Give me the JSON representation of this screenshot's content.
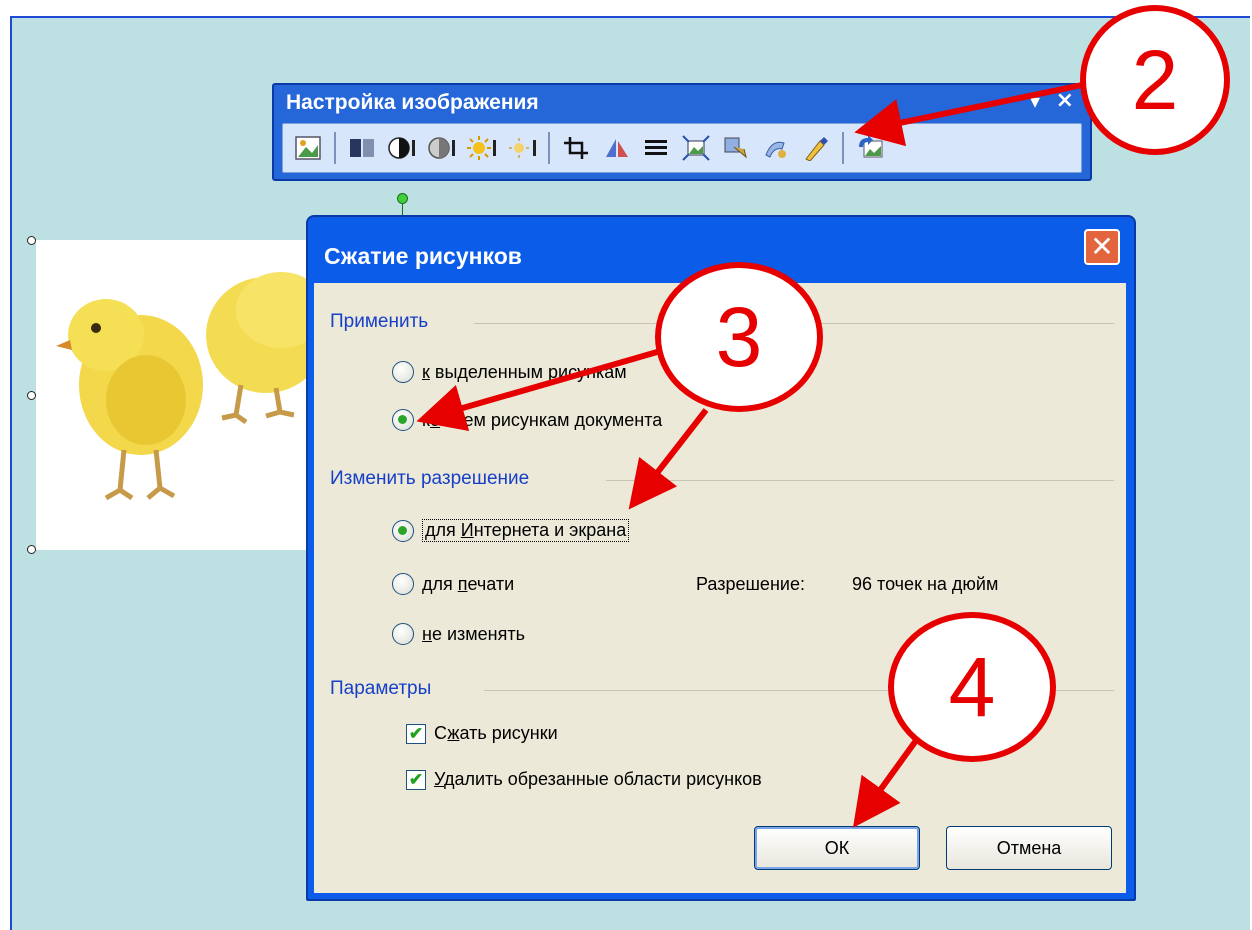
{
  "toolbar": {
    "title": "Настройка изображения",
    "minimize_label": "▾",
    "close_label": "×",
    "buttons": [
      "insert-picture-icon",
      "color-icon",
      "more-contrast-icon",
      "less-contrast-icon",
      "more-brightness-icon",
      "less-brightness-icon",
      "crop-icon",
      "rotate-left-icon",
      "line-style-icon",
      "compress-pictures-icon",
      "text-wrapping-icon",
      "format-picture-icon",
      "set-transparent-color-icon",
      "reset-picture-icon"
    ]
  },
  "dialog": {
    "title": "Сжатие рисунков",
    "close_label": "✕",
    "apply": {
      "label": "Применить",
      "option_selected": {
        "prefix": "",
        "underline": "к",
        "rest": " выделенным рисункам"
      },
      "option_all": {
        "prefix": "к",
        "underline": "о",
        "rest": " всем рисункам документа"
      },
      "selected": "all"
    },
    "resolution": {
      "label": "Изменить разрешение",
      "option_web": {
        "prefix": "для ",
        "underline": "И",
        "rest": "нтернета и экрана"
      },
      "option_print": {
        "prefix": "для ",
        "underline": "п",
        "rest": "ечати"
      },
      "option_none": {
        "prefix": "",
        "underline": "н",
        "rest": "е изменять"
      },
      "selected": "web",
      "info_label": "Разрешение:",
      "info_value": "96 точек на дюйм"
    },
    "params": {
      "label": "Параметры",
      "compress": {
        "prefix": "С",
        "underline": "ж",
        "rest": "ать рисунки",
        "checked": true
      },
      "delete_cropped": {
        "prefix": "",
        "underline": "У",
        "rest": "далить обрезанные области рисунков",
        "checked": true
      }
    },
    "ok_label": "ОК",
    "cancel_label": "Отмена"
  },
  "callouts": {
    "step2": "2",
    "step3": "3",
    "step4": "4"
  },
  "colors": {
    "callout": "#e60000",
    "title_bar": "#0b5ce8",
    "dialog_body": "#ece9d8",
    "canvas": "#bde0e3"
  }
}
